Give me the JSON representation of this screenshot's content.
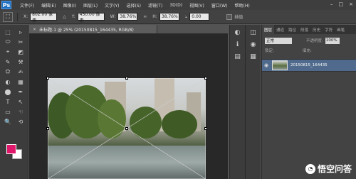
{
  "app": {
    "logo": "Ps"
  },
  "menu": [
    "文件(F)",
    "编辑(E)",
    "图像(I)",
    "图层(L)",
    "文字(Y)",
    "选择(S)",
    "滤镜(T)",
    "3D(D)",
    "视图(V)",
    "窗口(W)",
    "帮助(H)"
  ],
  "window_controls": {
    "minimize": "–",
    "maximize": "□",
    "close": "×"
  },
  "options": {
    "x_label": "X:",
    "x_value": "802.00 像素",
    "y_label": "Y:",
    "y_value": "450.00 像素",
    "w_label": "W:",
    "w_value": "38.76%",
    "h_label": "H:",
    "h_value": "38.76%",
    "angle_value": "0.00",
    "interp_label": "插值"
  },
  "document": {
    "tab_title": "未标题-1 @ 25% (20150815_164435, RGB/8)",
    "close": "×"
  },
  "tools": [
    "⬚",
    "▹",
    "⬭",
    "✂",
    "⌖",
    "◩",
    "✎",
    "⚒",
    "⛭",
    "✍",
    "◐",
    "▦",
    "⬤",
    "✒",
    "T",
    "↖",
    "▭",
    "☜",
    "🔍",
    "⟲"
  ],
  "colors": {
    "foreground": "#e0186b",
    "background": "#ffffff"
  },
  "side_icons": [
    "◐",
    "ℹ",
    "▤"
  ],
  "side_icons2": [
    "◫",
    "◉",
    "▦"
  ],
  "layers_panel": {
    "tabs": [
      "图层",
      "通道",
      "路径",
      "段落",
      "历史",
      "字符",
      "画笔"
    ],
    "active_tab": "图层",
    "blend_mode": "正常",
    "opacity_label": "不透明度:",
    "opacity_value": "100%",
    "lock_label": "锁定:",
    "fill_label": "填充:",
    "layers": [
      {
        "name": "20150815_164435"
      }
    ]
  },
  "watermark": {
    "text": "悟空问答",
    "logo": "◔"
  }
}
